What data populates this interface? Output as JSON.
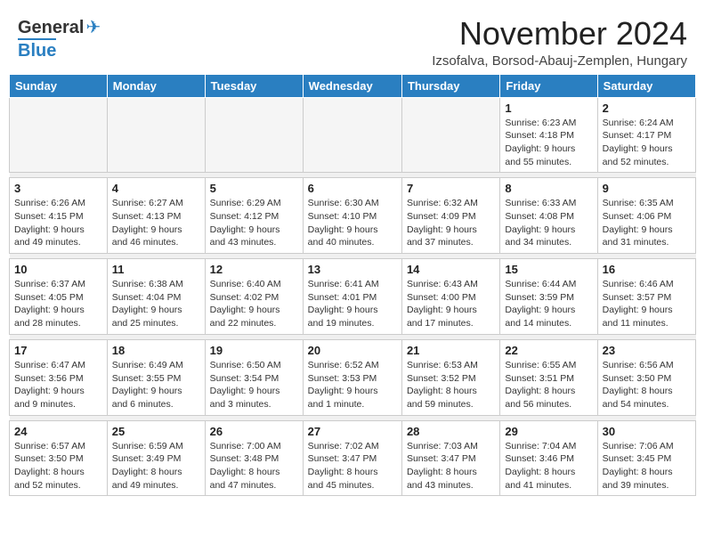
{
  "header": {
    "logo_line1": "General",
    "logo_line2": "Blue",
    "main_title": "November 2024",
    "subtitle": "Izsofalva, Borsod-Abauj-Zemplen, Hungary"
  },
  "days_of_week": [
    "Sunday",
    "Monday",
    "Tuesday",
    "Wednesday",
    "Thursday",
    "Friday",
    "Saturday"
  ],
  "weeks": [
    [
      {
        "day": "",
        "info": ""
      },
      {
        "day": "",
        "info": ""
      },
      {
        "day": "",
        "info": ""
      },
      {
        "day": "",
        "info": ""
      },
      {
        "day": "",
        "info": ""
      },
      {
        "day": "1",
        "info": "Sunrise: 6:23 AM\nSunset: 4:18 PM\nDaylight: 9 hours\nand 55 minutes."
      },
      {
        "day": "2",
        "info": "Sunrise: 6:24 AM\nSunset: 4:17 PM\nDaylight: 9 hours\nand 52 minutes."
      }
    ],
    [
      {
        "day": "3",
        "info": "Sunrise: 6:26 AM\nSunset: 4:15 PM\nDaylight: 9 hours\nand 49 minutes."
      },
      {
        "day": "4",
        "info": "Sunrise: 6:27 AM\nSunset: 4:13 PM\nDaylight: 9 hours\nand 46 minutes."
      },
      {
        "day": "5",
        "info": "Sunrise: 6:29 AM\nSunset: 4:12 PM\nDaylight: 9 hours\nand 43 minutes."
      },
      {
        "day": "6",
        "info": "Sunrise: 6:30 AM\nSunset: 4:10 PM\nDaylight: 9 hours\nand 40 minutes."
      },
      {
        "day": "7",
        "info": "Sunrise: 6:32 AM\nSunset: 4:09 PM\nDaylight: 9 hours\nand 37 minutes."
      },
      {
        "day": "8",
        "info": "Sunrise: 6:33 AM\nSunset: 4:08 PM\nDaylight: 9 hours\nand 34 minutes."
      },
      {
        "day": "9",
        "info": "Sunrise: 6:35 AM\nSunset: 4:06 PM\nDaylight: 9 hours\nand 31 minutes."
      }
    ],
    [
      {
        "day": "10",
        "info": "Sunrise: 6:37 AM\nSunset: 4:05 PM\nDaylight: 9 hours\nand 28 minutes."
      },
      {
        "day": "11",
        "info": "Sunrise: 6:38 AM\nSunset: 4:04 PM\nDaylight: 9 hours\nand 25 minutes."
      },
      {
        "day": "12",
        "info": "Sunrise: 6:40 AM\nSunset: 4:02 PM\nDaylight: 9 hours\nand 22 minutes."
      },
      {
        "day": "13",
        "info": "Sunrise: 6:41 AM\nSunset: 4:01 PM\nDaylight: 9 hours\nand 19 minutes."
      },
      {
        "day": "14",
        "info": "Sunrise: 6:43 AM\nSunset: 4:00 PM\nDaylight: 9 hours\nand 17 minutes."
      },
      {
        "day": "15",
        "info": "Sunrise: 6:44 AM\nSunset: 3:59 PM\nDaylight: 9 hours\nand 14 minutes."
      },
      {
        "day": "16",
        "info": "Sunrise: 6:46 AM\nSunset: 3:57 PM\nDaylight: 9 hours\nand 11 minutes."
      }
    ],
    [
      {
        "day": "17",
        "info": "Sunrise: 6:47 AM\nSunset: 3:56 PM\nDaylight: 9 hours\nand 9 minutes."
      },
      {
        "day": "18",
        "info": "Sunrise: 6:49 AM\nSunset: 3:55 PM\nDaylight: 9 hours\nand 6 minutes."
      },
      {
        "day": "19",
        "info": "Sunrise: 6:50 AM\nSunset: 3:54 PM\nDaylight: 9 hours\nand 3 minutes."
      },
      {
        "day": "20",
        "info": "Sunrise: 6:52 AM\nSunset: 3:53 PM\nDaylight: 9 hours\nand 1 minute."
      },
      {
        "day": "21",
        "info": "Sunrise: 6:53 AM\nSunset: 3:52 PM\nDaylight: 8 hours\nand 59 minutes."
      },
      {
        "day": "22",
        "info": "Sunrise: 6:55 AM\nSunset: 3:51 PM\nDaylight: 8 hours\nand 56 minutes."
      },
      {
        "day": "23",
        "info": "Sunrise: 6:56 AM\nSunset: 3:50 PM\nDaylight: 8 hours\nand 54 minutes."
      }
    ],
    [
      {
        "day": "24",
        "info": "Sunrise: 6:57 AM\nSunset: 3:50 PM\nDaylight: 8 hours\nand 52 minutes."
      },
      {
        "day": "25",
        "info": "Sunrise: 6:59 AM\nSunset: 3:49 PM\nDaylight: 8 hours\nand 49 minutes."
      },
      {
        "day": "26",
        "info": "Sunrise: 7:00 AM\nSunset: 3:48 PM\nDaylight: 8 hours\nand 47 minutes."
      },
      {
        "day": "27",
        "info": "Sunrise: 7:02 AM\nSunset: 3:47 PM\nDaylight: 8 hours\nand 45 minutes."
      },
      {
        "day": "28",
        "info": "Sunrise: 7:03 AM\nSunset: 3:47 PM\nDaylight: 8 hours\nand 43 minutes."
      },
      {
        "day": "29",
        "info": "Sunrise: 7:04 AM\nSunset: 3:46 PM\nDaylight: 8 hours\nand 41 minutes."
      },
      {
        "day": "30",
        "info": "Sunrise: 7:06 AM\nSunset: 3:45 PM\nDaylight: 8 hours\nand 39 minutes."
      }
    ]
  ]
}
